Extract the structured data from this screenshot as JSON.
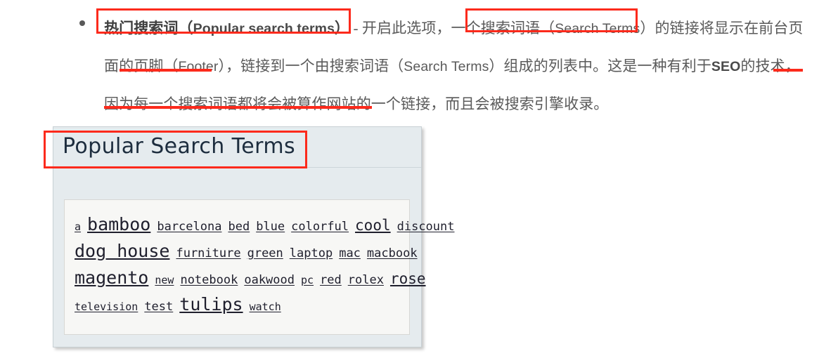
{
  "article": {
    "bullet_marker": "•",
    "line1_a": "热门搜索词",
    "line1_b": "（",
    "line1_c": "Popular search terms",
    "line1_d": "）",
    "line1_e": " - 开启此选项，一个搜索词语（",
    "line1_f": "Search Terms",
    "line1_g": "）的链接将显示在前台页面的页脚（",
    "line1_h": "Footer",
    "line1_i": "），链接到一个由搜索词语（",
    "line1_j": "Search Terms",
    "line1_k": "）组成的列表中。这是一种有利于",
    "line1_l": "SEO",
    "line1_m": "的技术，因为每一个搜索词语都将会被算作网站的一个链接，而且会被搜索引擎收录。",
    "full_text": "热门搜索词（Popular search terms） - 开启此选项，一个搜索词语（Search Terms）的链接将显示在前台页面的页脚（Footer），链接到一个由搜索词语（Search Terms）组成的列表中。这是一种有利于SEO的技术，因为每一个搜索词语都将会被算作网站的一个链接，而且会被搜索引擎收录。"
  },
  "annotations": {
    "color": "#fc2a1c",
    "boxes": [
      {
        "name": "highlight-box-popular-search-terms",
        "label": "热门搜索词（Popular search terms）"
      },
      {
        "name": "highlight-box-search-terms-link",
        "label": "搜索词语（Search Terms）"
      },
      {
        "name": "highlight-box-widget-title",
        "label": "Popular Search Terms"
      }
    ],
    "underlines": [
      {
        "name": "underline-footer",
        "label": "页脚（Footer）"
      },
      {
        "name": "underline-mei",
        "label": "每"
      },
      {
        "name": "underline-link-sentence",
        "label": "一个搜索词语都将会被算作网站的一个链接，"
      }
    ]
  },
  "widget": {
    "title": "Popular Search Terms",
    "background_color": "#e5ebee",
    "title_color": "#1d2d3e",
    "tag_cloud": {
      "rows": [
        [
          {
            "text": "a",
            "size": 2
          },
          {
            "text": "bamboo",
            "size": 5
          },
          {
            "text": "barcelona",
            "size": 3
          },
          {
            "text": "bed",
            "size": 3
          },
          {
            "text": "blue",
            "size": 3
          },
          {
            "text": "colorful",
            "size": 3
          },
          {
            "text": "cool",
            "size": 4
          },
          {
            "text": "discount",
            "size": 3
          }
        ],
        [
          {
            "text": "dog house",
            "size": 5
          },
          {
            "text": "furniture",
            "size": 3
          },
          {
            "text": "green",
            "size": 3
          },
          {
            "text": "laptop",
            "size": 3
          },
          {
            "text": "mac",
            "size": 3
          },
          {
            "text": "macbook",
            "size": 3
          }
        ],
        [
          {
            "text": "magento",
            "size": 5
          },
          {
            "text": "new",
            "size": 2
          },
          {
            "text": "notebook",
            "size": 3
          },
          {
            "text": "oakwood",
            "size": 3
          },
          {
            "text": "pc",
            "size": 2
          },
          {
            "text": "red",
            "size": 3
          },
          {
            "text": "rolex",
            "size": 3
          },
          {
            "text": "rose",
            "size": 4
          }
        ],
        [
          {
            "text": "television",
            "size": 2
          },
          {
            "text": "test",
            "size": 3
          },
          {
            "text": "tulips",
            "size": 5
          },
          {
            "text": "watch",
            "size": 2
          }
        ]
      ]
    }
  }
}
